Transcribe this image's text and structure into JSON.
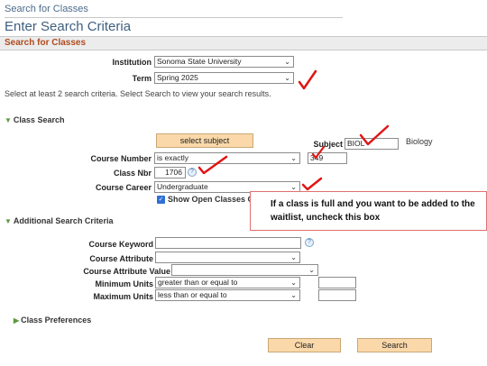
{
  "breadcrumb": "Search for Classes",
  "page_title": "Enter Search Criteria",
  "section_header": "Search for Classes",
  "institution": {
    "label": "Institution",
    "value": "Sonoma State University"
  },
  "term": {
    "label": "Term",
    "value": "Spring 2025"
  },
  "instructions": "Select at least 2 search criteria. Select Search to view your search results.",
  "class_search": {
    "heading": "Class Search",
    "select_subject_label": "select subject",
    "subject": {
      "label": "Subject",
      "value": "BIOL",
      "description": "Biology"
    },
    "course_number": {
      "label": "Course Number",
      "operator": "is exactly",
      "value": "349"
    },
    "class_nbr": {
      "label": "Class Nbr",
      "value": "1706"
    },
    "course_career": {
      "label": "Course Career",
      "value": "Undergraduate"
    },
    "open_only": {
      "label": "Show Open Classes Only",
      "checked": true
    }
  },
  "annotation": "If a class is full and you want to be added to the waitlist, uncheck this box",
  "additional": {
    "heading": "Additional Search Criteria",
    "course_keyword": {
      "label": "Course Keyword",
      "value": ""
    },
    "course_attribute": {
      "label": "Course Attribute",
      "value": ""
    },
    "course_attribute_value": {
      "label": "Course Attribute Value",
      "value": ""
    },
    "minimum_units": {
      "label": "Minimum Units",
      "operator": "greater than or equal to",
      "value": ""
    },
    "maximum_units": {
      "label": "Maximum Units",
      "operator": "less than or equal to",
      "value": ""
    }
  },
  "class_preferences": {
    "heading": "Class Preferences"
  },
  "buttons": {
    "clear": "Clear",
    "search": "Search"
  },
  "icons": {
    "dropdown": "chevron-down-icon",
    "help": "help-icon",
    "check": "checkmark-annotation-icon"
  },
  "colors": {
    "section_header": "#b04a1e",
    "button": "#fad8a9",
    "annotation_mark": "#e01616"
  }
}
